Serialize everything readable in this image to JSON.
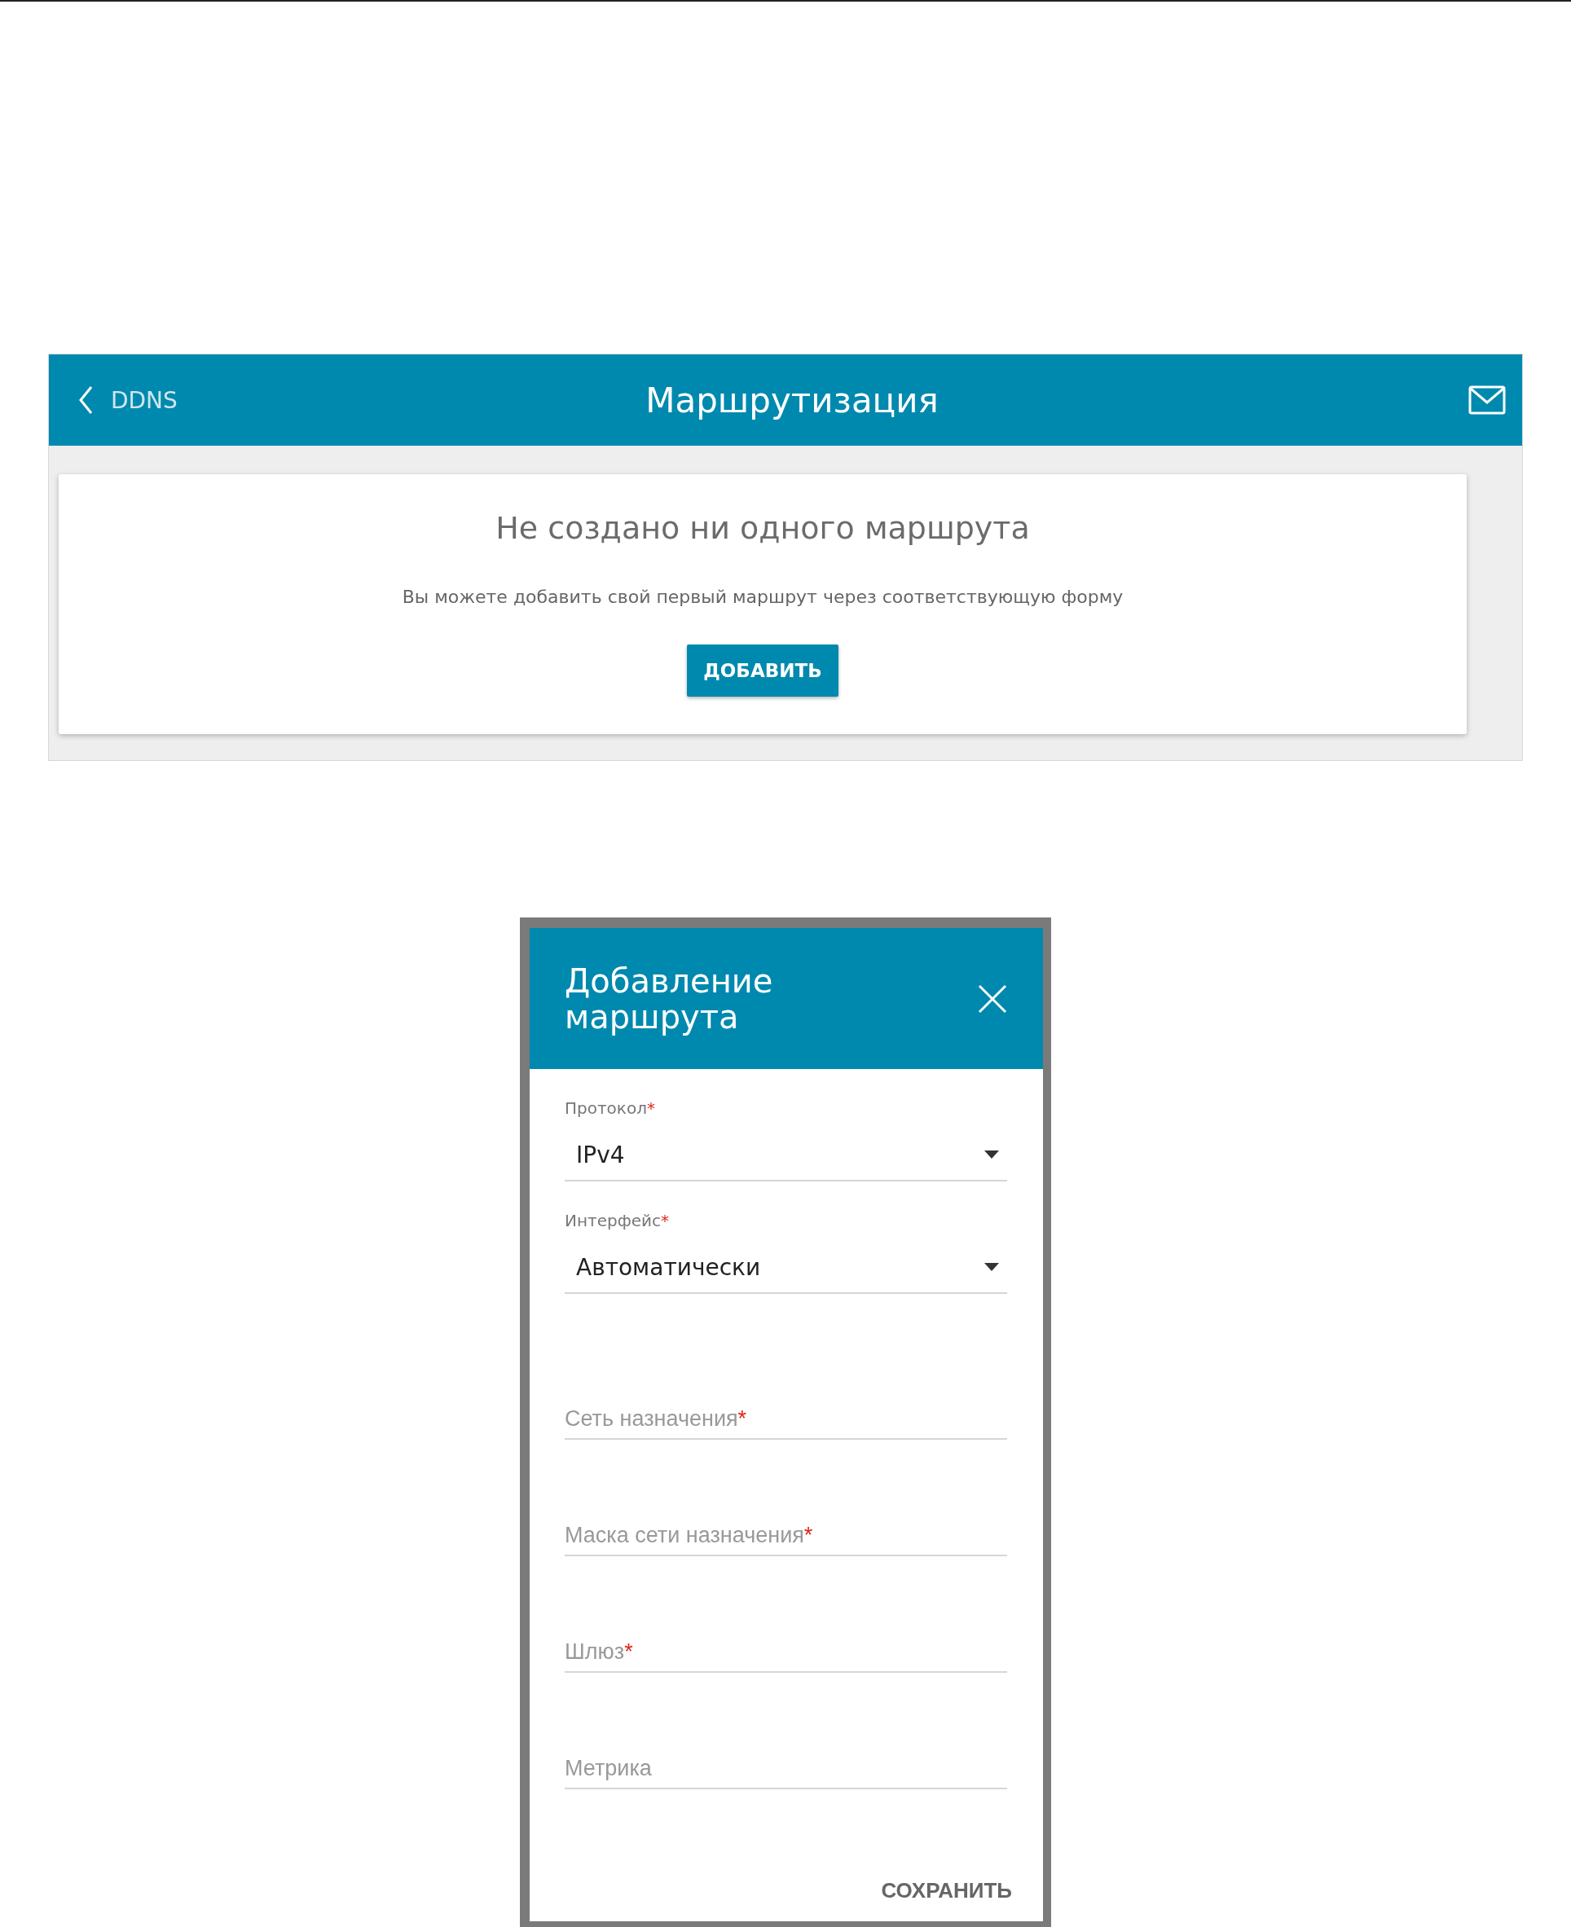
{
  "page_header": {
    "back_link": "DDNS",
    "title": "Маршрутизация"
  },
  "empty_state": {
    "heading": "Не создано ни одного маршрута",
    "text": "Вы можете добавить свой первый маршрут через соответствующую форму",
    "button": "ДОБАВИТЬ"
  },
  "dialog": {
    "title": "Добавление маршрута",
    "fields": [
      {
        "kind": "select",
        "label": "Протокол",
        "required_mark": "*",
        "value": "IPv4"
      },
      {
        "kind": "select",
        "label": "Интерфейс",
        "required_mark": "*",
        "value": "Автоматически"
      },
      {
        "kind": "text",
        "label": "Сеть назначения",
        "required_mark": "*"
      },
      {
        "kind": "text",
        "label": "Маска сети назначения",
        "required_mark": "*"
      },
      {
        "kind": "text",
        "label": "Шлюз",
        "required_mark": "*"
      },
      {
        "kind": "text",
        "label": "Метрика"
      }
    ],
    "save_button": "СОХРАНИТЬ"
  }
}
